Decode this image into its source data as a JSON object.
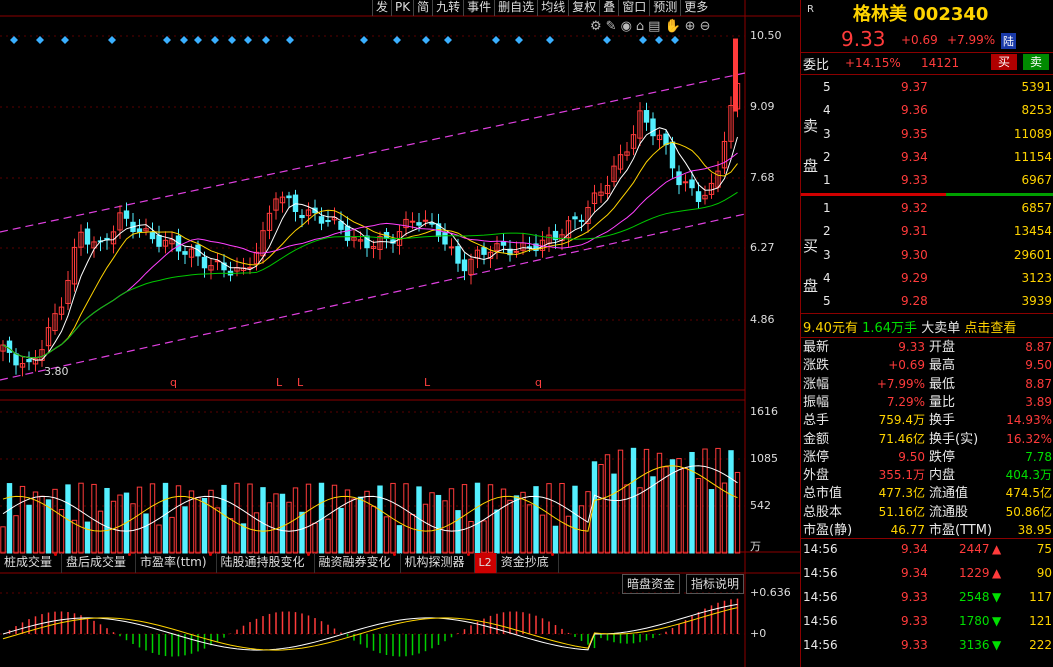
{
  "toolbar": [
    "发",
    "PK",
    "简",
    "九转",
    "事件",
    "删自选",
    "均线",
    "复权",
    "叠",
    "窗口",
    "预测",
    "更多"
  ],
  "price_axis": [
    "10.50",
    "9.09",
    "7.68",
    "6.27",
    "4.86"
  ],
  "low_label": "3.80",
  "markers": [
    "q",
    "L",
    "L",
    "L",
    "q"
  ],
  "vol_axis": [
    "1616",
    "1085",
    "542"
  ],
  "vol_unit": "万",
  "tabs": [
    "桩成交量",
    "盘后成交量",
    "市盈率(ttm)",
    "陆股通持股变化",
    "融资融券变化",
    "机构探测器",
    "资金抄底"
  ],
  "l2_badge": "L2",
  "macd_buttons": {
    "dark_pool": "暗盘资金",
    "indicator_help": "指标说明"
  },
  "macd_axis": [
    "+0.636",
    "+0"
  ],
  "header": {
    "r": "R",
    "name": "格林美",
    "code": "002340",
    "price": "9.33",
    "change": "+0.69",
    "pct": "+7.99%",
    "tag": "陆"
  },
  "weibi": {
    "label": "委比",
    "pct": "+14.15%",
    "diff": "14121",
    "buy": "买",
    "sell": "卖"
  },
  "sell_label": [
    "卖",
    "盘"
  ],
  "buy_label": [
    "买",
    "盘"
  ],
  "asks": [
    {
      "lv": "5",
      "price": "9.37",
      "vol": "5391"
    },
    {
      "lv": "4",
      "price": "9.36",
      "vol": "8253"
    },
    {
      "lv": "3",
      "price": "9.35",
      "vol": "11089"
    },
    {
      "lv": "2",
      "price": "9.34",
      "vol": "11154"
    },
    {
      "lv": "1",
      "price": "9.33",
      "vol": "6967"
    }
  ],
  "bids": [
    {
      "lv": "1",
      "price": "9.32",
      "vol": "6857"
    },
    {
      "lv": "2",
      "price": "9.31",
      "vol": "13454"
    },
    {
      "lv": "3",
      "price": "9.30",
      "vol": "29601"
    },
    {
      "lv": "4",
      "price": "9.29",
      "vol": "3123"
    },
    {
      "lv": "5",
      "price": "9.28",
      "vol": "3939"
    }
  ],
  "bigorder": {
    "price": "9.40元有",
    "qty": "1.64万手",
    "label": "大卖单",
    "link": "点击查看"
  },
  "stats": [
    [
      "最新",
      "9.33",
      "开盘",
      "8.87"
    ],
    [
      "涨跌",
      "+0.69",
      "最高",
      "9.50"
    ],
    [
      "涨幅",
      "+7.99%",
      "最低",
      "8.87"
    ],
    [
      "振幅",
      "7.29%",
      "量比",
      "3.89"
    ],
    [
      "总手",
      "759.4万",
      "换手",
      "14.93%"
    ],
    [
      "金额",
      "71.46亿",
      "换手(实)",
      "16.32%"
    ],
    [
      "涨停",
      "9.50",
      "跌停",
      "7.78"
    ],
    [
      "外盘",
      "355.1万",
      "内盘",
      "404.3万"
    ],
    [
      "总市值",
      "477.3亿",
      "流通值",
      "474.5亿"
    ],
    [
      "总股本",
      "51.16亿",
      "流通股",
      "50.86亿"
    ],
    [
      "市盈(静)",
      "46.77",
      "市盈(TTM)",
      "38.95"
    ]
  ],
  "ticks": [
    {
      "time": "14:56",
      "price": "9.34",
      "vol": "2447",
      "dir": "up",
      "n": "75"
    },
    {
      "time": "14:56",
      "price": "9.34",
      "vol": "1229",
      "dir": "up",
      "n": "90"
    },
    {
      "time": "14:56",
      "price": "9.33",
      "vol": "2548",
      "dir": "down",
      "n": "117"
    },
    {
      "time": "14:56",
      "price": "9.33",
      "vol": "1780",
      "dir": "down",
      "n": "121"
    },
    {
      "time": "14:56",
      "price": "9.33",
      "vol": "3136",
      "dir": "down",
      "n": "222"
    }
  ],
  "colors": {
    "up": "#ff3b3b",
    "down": "#54f0ff",
    "ma5": "#ffffff",
    "ma10": "#ffd400",
    "ma20": "#ff40ff",
    "ma60": "#00c800",
    "channel": "#e040e0"
  },
  "chart_data": {
    "type": "candlestick",
    "price_ticks": [
      10.5,
      9.09,
      7.68,
      6.27,
      4.86
    ],
    "low_marker": 3.8,
    "last_close": 9.33,
    "volume_ticks": [
      1616,
      1085,
      542
    ],
    "volume_unit": "万",
    "macd_ticks": [
      0.636,
      0
    ]
  }
}
